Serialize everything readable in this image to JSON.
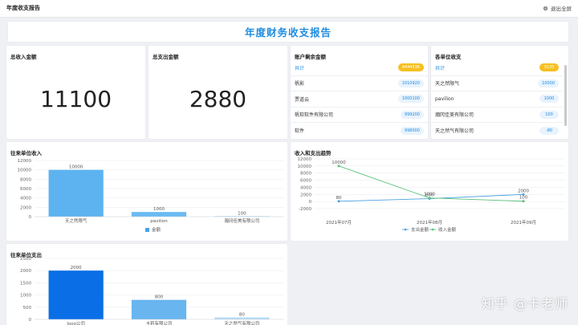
{
  "header": {
    "title": "年度收支报告",
    "exit_label": "退出全屏",
    "exit_icon": "exit-fullscreen-icon"
  },
  "page_title": "年度财务收支报告",
  "kpi": {
    "income": {
      "label": "总收入金额",
      "value": "11100"
    },
    "expense": {
      "label": "总支出金额",
      "value": "2880"
    }
  },
  "balance": {
    "label": "账户剩余金额",
    "rows": [
      {
        "name": "共计",
        "value": "4444536"
      },
      {
        "name": "帆影",
        "value": "1010920"
      },
      {
        "name": "贾道云",
        "value": "1000100"
      },
      {
        "name": "帆软软件有限公司",
        "value": "999200"
      },
      {
        "name": "软件",
        "value": "998000"
      }
    ]
  },
  "unit_income": {
    "label": "各单位收支",
    "rows": [
      {
        "name": "共计",
        "value": "3220"
      },
      {
        "name": "天之然限气",
        "value": "10000"
      },
      {
        "name": "pavilion",
        "value": "1000"
      },
      {
        "name": "瀚冈佳美有限公司",
        "value": "100"
      },
      {
        "name": "天之然气有限公司",
        "value": "-80"
      }
    ]
  },
  "chart_data": [
    {
      "type": "bar",
      "title": "往来单位收入",
      "categories": [
        "天之然限气",
        "pavilion",
        "瀚冈佳美有限公司"
      ],
      "series": [
        {
          "name": "金额",
          "values": [
            10000,
            1000,
            100
          ]
        }
      ],
      "ylim": [
        0,
        12000
      ],
      "yticks": [
        "12000",
        "10000",
        "8000",
        "6000",
        "4000",
        "2000",
        "0"
      ],
      "legend": "bottom"
    },
    {
      "type": "line",
      "title": "收入和支出趋势",
      "categories": [
        "2021年07月",
        "2021年08月",
        "2021年09月"
      ],
      "series": [
        {
          "name": "支出金额",
          "color": "#4aa3e6",
          "values": [
            80,
            800,
            2000
          ]
        },
        {
          "name": "收入金额",
          "color": "#5ac17a",
          "values": [
            10000,
            1000,
            100
          ]
        }
      ],
      "ylim": [
        -2000,
        12000
      ],
      "yticks": [
        "12000",
        "10000",
        "8000",
        "6000",
        "4000",
        "2000",
        "0",
        "-2000"
      ],
      "legend": "bottom"
    },
    {
      "type": "bar",
      "title": "往来单位支出",
      "categories": [
        "Jooo公司",
        "卡莉有限公司",
        "天之然气有限公司"
      ],
      "series": [
        {
          "name": "金额",
          "values": [
            2000,
            800,
            80
          ]
        }
      ],
      "ylim": [
        0,
        2500
      ],
      "yticks": [
        "2500",
        "2000",
        "1500",
        "1000",
        "500",
        "0"
      ]
    }
  ],
  "watermark": "知乎 @卡老师"
}
